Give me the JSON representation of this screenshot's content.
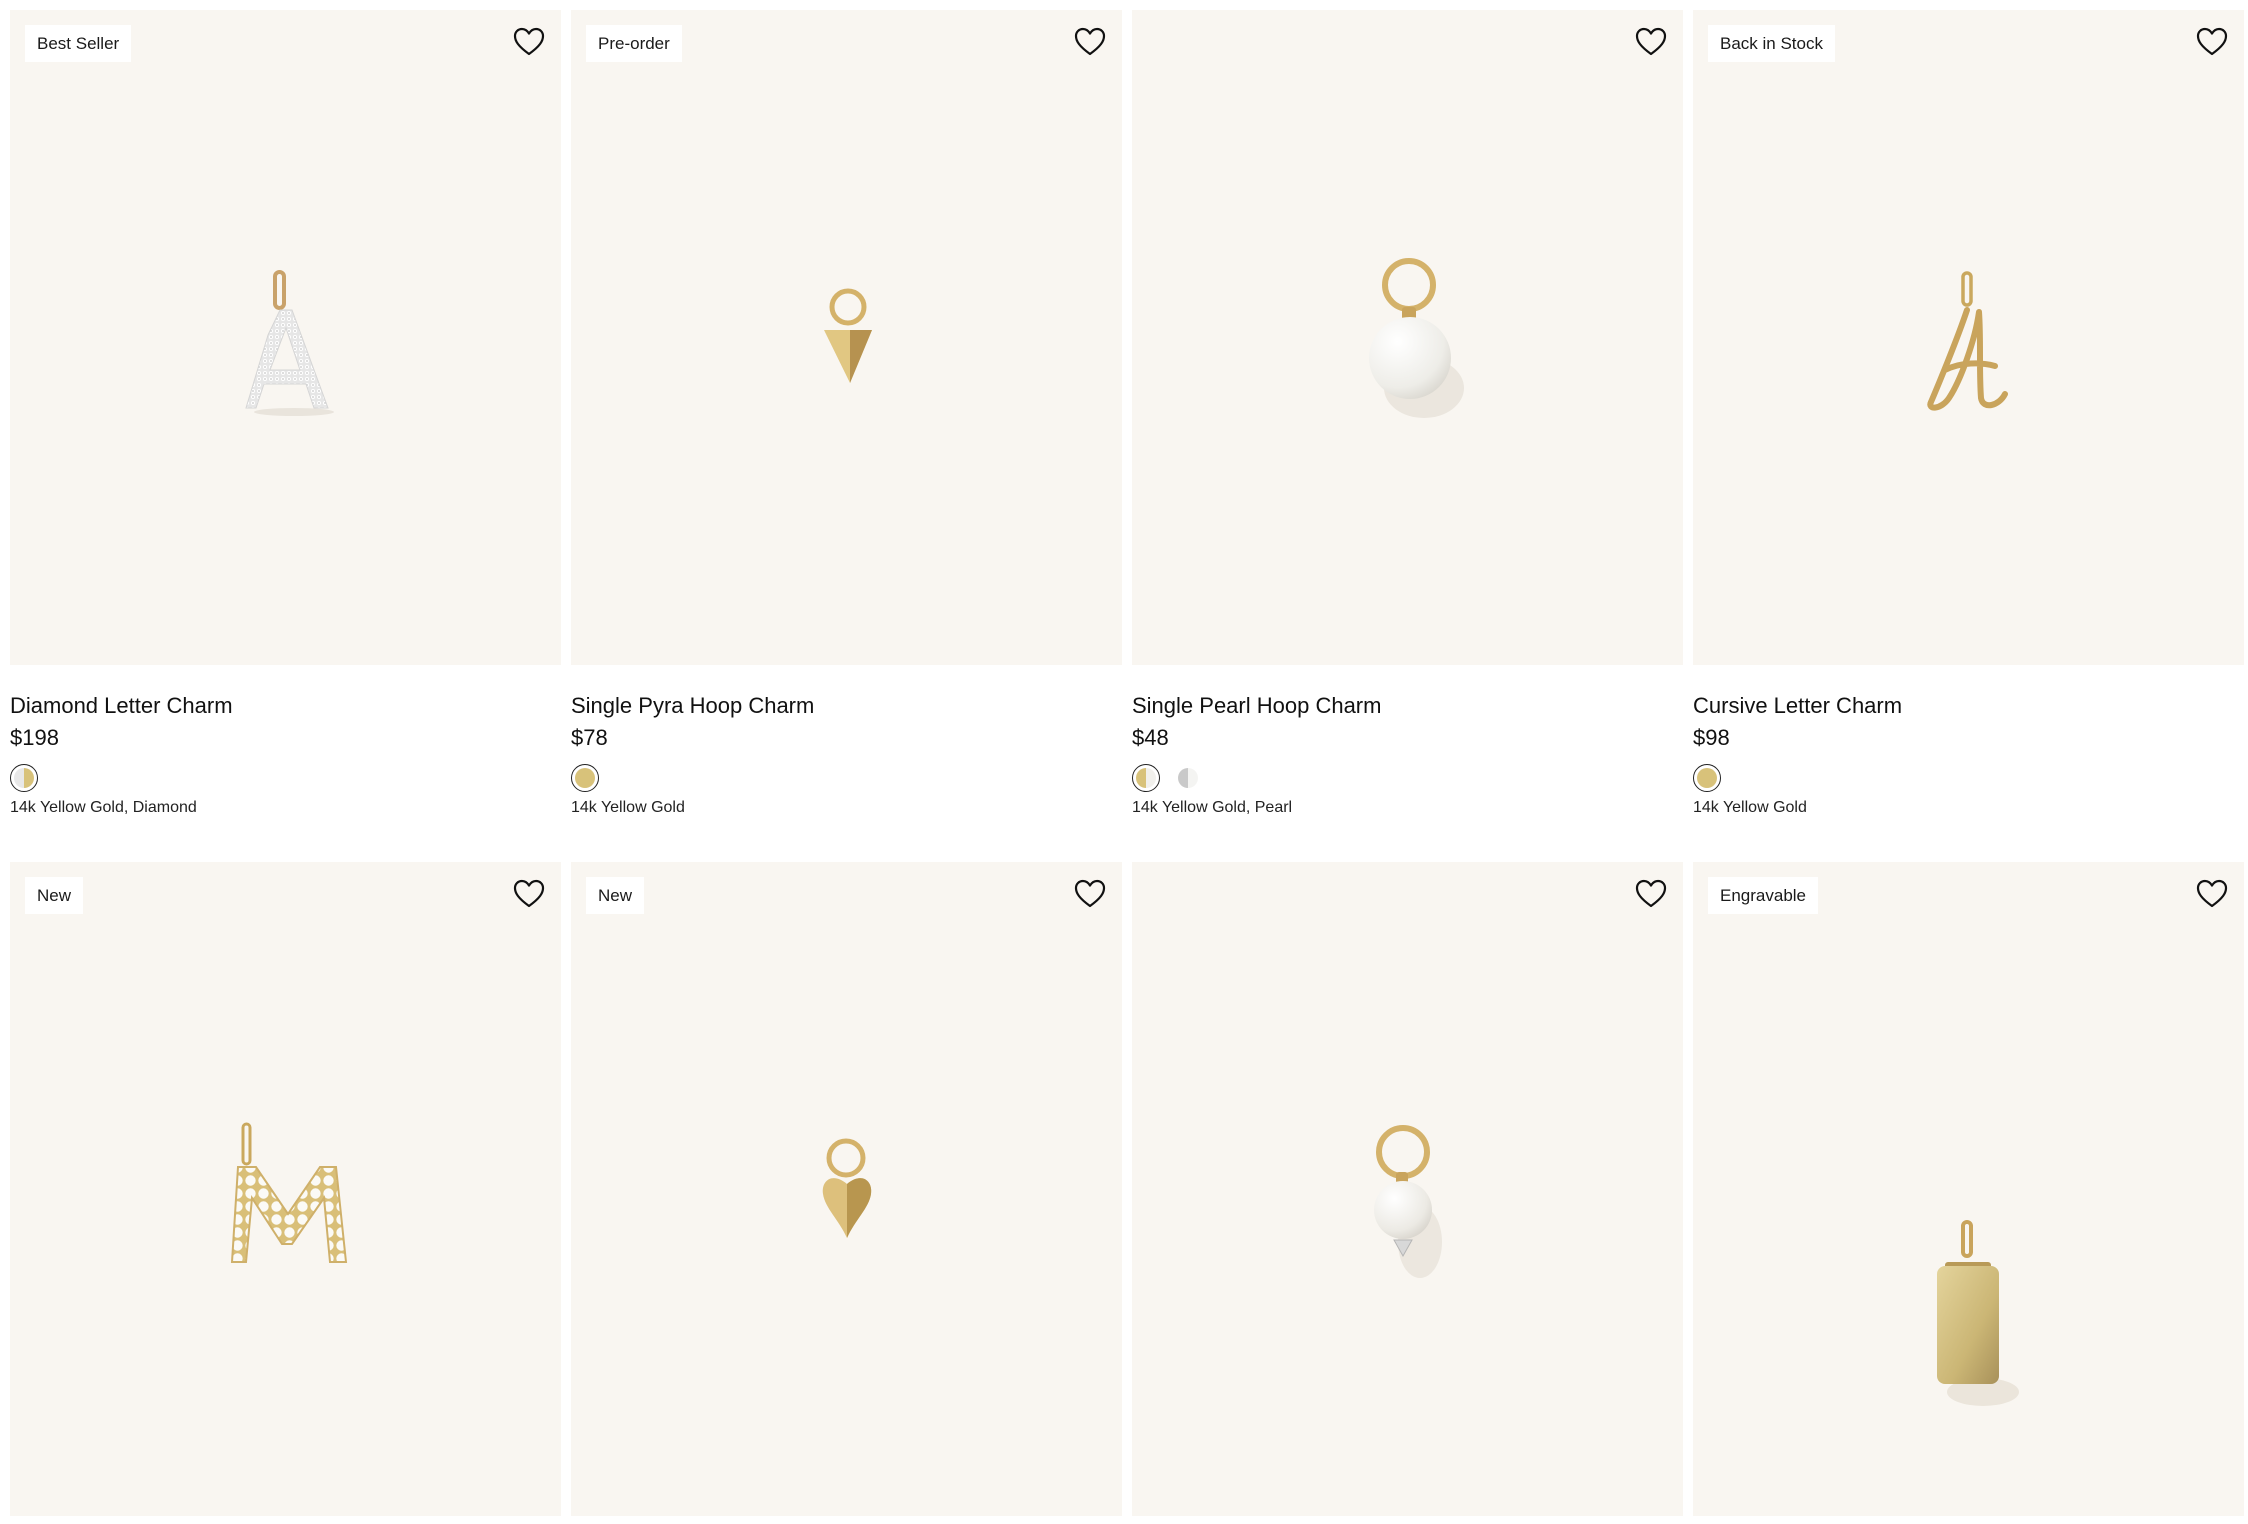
{
  "colors": {
    "card_bg": "#f9f6f1",
    "gold": "#d8c27a",
    "silver": "#dcdcdc",
    "pearl": "#f1f0ec"
  },
  "products": [
    {
      "badge": "Best Seller",
      "name": "Diamond Letter Charm",
      "price": "$198",
      "material": "14k Yellow Gold, Diamond",
      "art": "diamond-letter-a-charm",
      "swatches": [
        "gold-diamond"
      ]
    },
    {
      "badge": "Pre-order",
      "name": "Single Pyra Hoop Charm",
      "price": "$78",
      "material": "14k Yellow Gold",
      "art": "pyramid-hoop-charm",
      "swatches": [
        "gold"
      ]
    },
    {
      "badge": "",
      "name": "Single Pearl Hoop Charm",
      "price": "$48",
      "material": "14k Yellow Gold, Pearl",
      "art": "pearl-hoop-charm",
      "swatches": [
        "gold-pearl",
        "silver-pearl"
      ]
    },
    {
      "badge": "Back in Stock",
      "name": "Cursive Letter Charm",
      "price": "$98",
      "material": "14k Yellow Gold",
      "art": "cursive-letter-a-charm",
      "swatches": [
        "gold"
      ]
    },
    {
      "badge": "New",
      "art": "pearl-letter-m-charm"
    },
    {
      "badge": "New",
      "art": "heart-hoop-charm"
    },
    {
      "badge": "",
      "art": "pearl-diamond-hoop-charm"
    },
    {
      "badge": "Engravable",
      "art": "gold-tag-charm"
    }
  ]
}
